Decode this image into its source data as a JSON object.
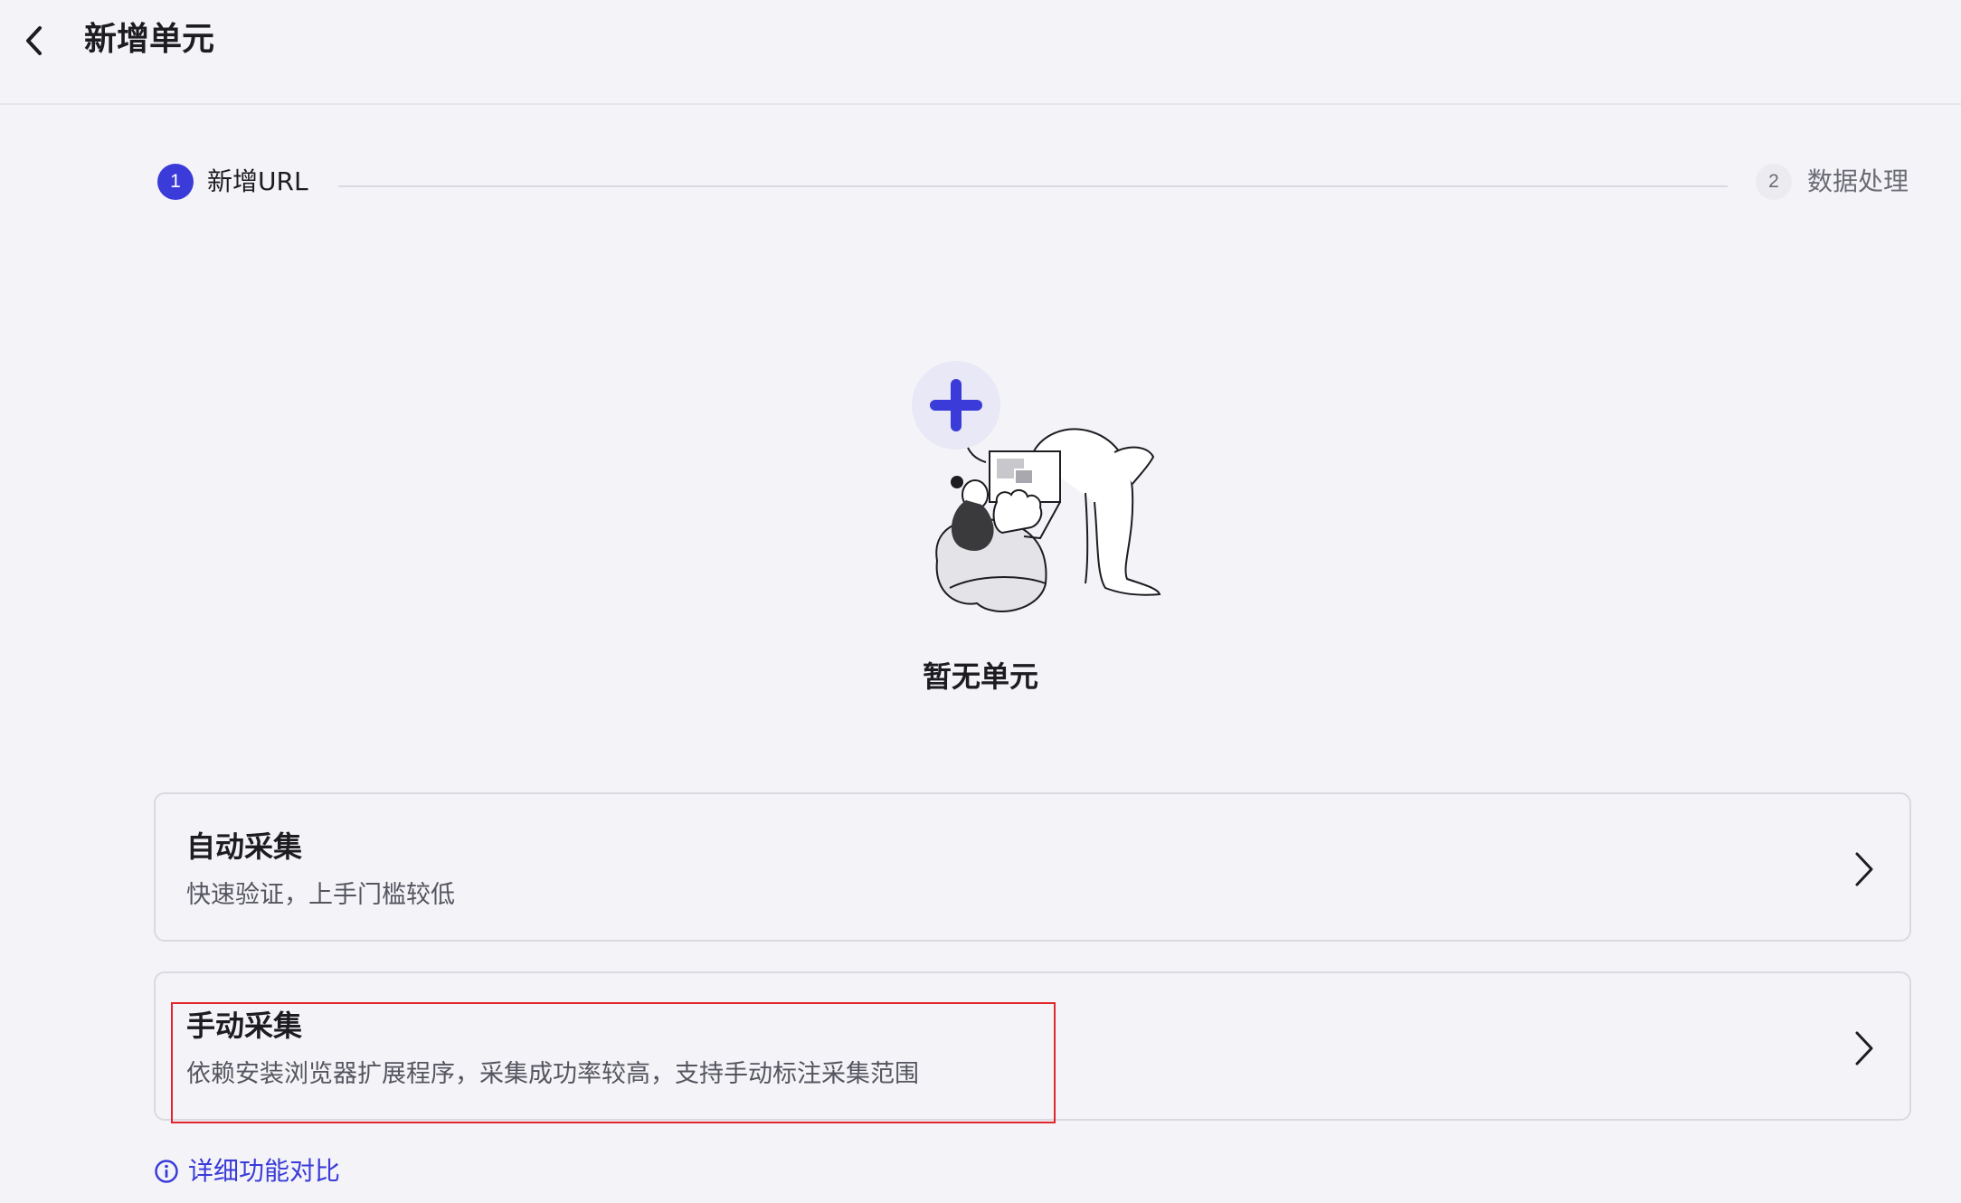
{
  "header": {
    "title": "新增单元",
    "back_icon": "chevron-left-icon"
  },
  "steps": [
    {
      "number": "1",
      "label": "新增URL",
      "state": "active"
    },
    {
      "number": "2",
      "label": "数据处理",
      "state": "pending"
    }
  ],
  "empty_state": {
    "text": "暂无单元",
    "illustration": "person-with-laptop-and-plus-icon"
  },
  "options": [
    {
      "title": "自动采集",
      "description": "快速验证，上手门槛较低",
      "icon": "chevron-right-icon"
    },
    {
      "title": "手动采集",
      "description": "依赖安装浏览器扩展程序，采集成功率较高，支持手动标注采集范围",
      "icon": "chevron-right-icon"
    }
  ],
  "compare_link": {
    "label": "详细功能对比",
    "icon": "info-circle-icon"
  },
  "colors": {
    "accent": "#3b3bd9",
    "background": "#f4f4f8",
    "highlight": "#e0262a"
  }
}
